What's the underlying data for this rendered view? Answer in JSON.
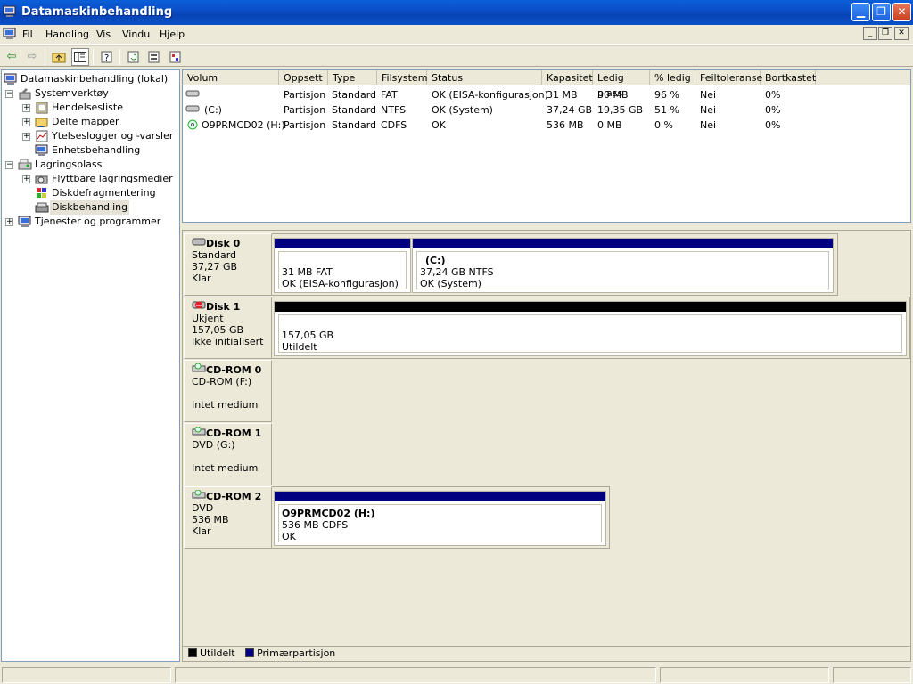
{
  "window": {
    "title": "Datamaskinbehandling"
  },
  "menu": {
    "items": [
      "Fil",
      "Handling",
      "Vis",
      "Vindu",
      "Hjelp"
    ]
  },
  "tree": {
    "root": "Datamaskinbehandling (lokal)",
    "systemverktoy": "Systemverktøy",
    "hendelsesliste": "Hendelsesliste",
    "delte_mapper": "Delte mapper",
    "ytelseslogger": "Ytelseslogger og -varsler",
    "enhetsbehandling": "Enhetsbehandling",
    "lagringsplass": "Lagringsplass",
    "flyttbare": "Flyttbare lagringsmedier",
    "diskdefrag": "Diskdefragmentering",
    "diskbehandling": "Diskbehandling",
    "tjenester": "Tjenester og programmer"
  },
  "volumes": {
    "columns": [
      "Volum",
      "Oppsett",
      "Type",
      "Filsystem",
      "Status",
      "Kapasitet",
      "Ledig plass",
      "% ledig",
      "Feiltoleranse",
      "Bortkastet"
    ],
    "rows": [
      {
        "volum": "",
        "oppsett": "Partisjon",
        "type": "Standard",
        "fs": "FAT",
        "status": "OK (EISA-konfigurasjon)",
        "kap": "31 MB",
        "ledig": "30 MB",
        "pct": "96 %",
        "feil": "Nei",
        "bort": "0%"
      },
      {
        "volum": "(C:)",
        "oppsett": "Partisjon",
        "type": "Standard",
        "fs": "NTFS",
        "status": "OK (System)",
        "kap": "37,24 GB",
        "ledig": "19,35 GB",
        "pct": "51 %",
        "feil": "Nei",
        "bort": "0%"
      },
      {
        "volum": "O9PRMCD02 (H:)",
        "oppsett": "Partisjon",
        "type": "Standard",
        "fs": "CDFS",
        "status": "OK",
        "kap": "536 MB",
        "ledig": "0 MB",
        "pct": "0 %",
        "feil": "Nei",
        "bort": "0%"
      }
    ]
  },
  "disks": {
    "disk0": {
      "name": "Disk 0",
      "l1": "Standard",
      "l2": "37,27 GB",
      "l3": "Klar",
      "p1": {
        "l1": "31 MB FAT",
        "l2": "OK (EISA-konfigurasjon)"
      },
      "p2": {
        "name": "(C:)",
        "l1": "37,24 GB NTFS",
        "l2": "OK (System)"
      }
    },
    "disk1": {
      "name": "Disk 1",
      "l1": "Ukjent",
      "l2": "157,05 GB",
      "l3": "Ikke initialisert",
      "p1": {
        "l1": "157,05 GB",
        "l2": "Utildelt"
      }
    },
    "cdrom0": {
      "name": "CD-ROM 0",
      "l1": "CD-ROM (F:)",
      "l3": "Intet medium"
    },
    "cdrom1": {
      "name": "CD-ROM 1",
      "l1": "DVD (G:)",
      "l3": "Intet medium"
    },
    "cdrom2": {
      "name": "CD-ROM 2",
      "l1": "DVD",
      "l2": "536 MB",
      "l3": "Klar",
      "p1": {
        "name": "O9PRMCD02  (H:)",
        "l1": "536 MB CDFS",
        "l2": "OK"
      }
    }
  },
  "legend": {
    "unallocated": "Utildelt",
    "primary": "Primærpartisjon"
  },
  "colors": {
    "primary": "#000080",
    "unallocated": "#000000",
    "titlebar": "#0a50c8"
  }
}
